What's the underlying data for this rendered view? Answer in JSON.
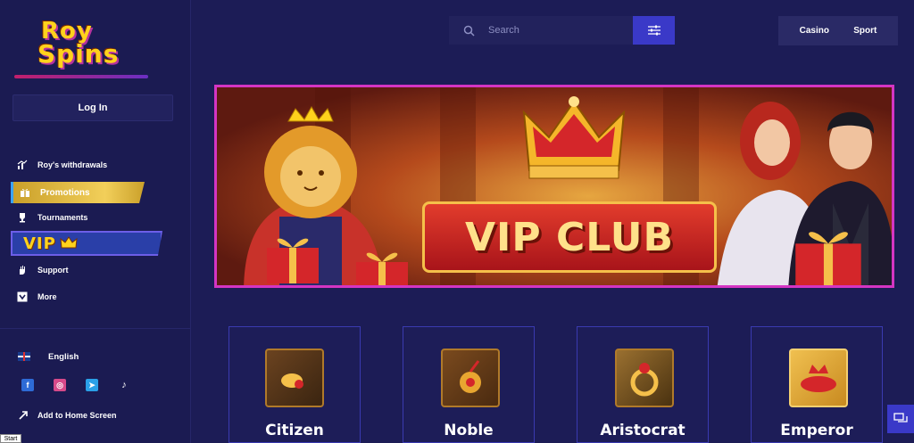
{
  "brand": {
    "logo_line1": "Roy",
    "logo_line2": "Spins",
    "colors": {
      "gold": "#ffd21c",
      "accent": "#3a39c8",
      "bg": "#1c1c56"
    }
  },
  "sidebar": {
    "login_label": "Log In",
    "items": [
      {
        "label": "Roy's withdrawals",
        "icon": "chart-icon"
      },
      {
        "label": "Promotions",
        "icon": "gift-icon"
      },
      {
        "label": "Tournaments",
        "icon": "trophy-icon"
      },
      {
        "label": "VIP",
        "icon": "crown-icon"
      },
      {
        "label": "Support",
        "icon": "hand-icon"
      },
      {
        "label": "More",
        "icon": "chevron-down-icon"
      }
    ],
    "language": "English",
    "socials": [
      "facebook-icon",
      "instagram-icon",
      "telegram-icon",
      "tiktok-icon"
    ],
    "add_home_label": "Add to Home Screen"
  },
  "header": {
    "search_placeholder": "Search",
    "tabs": [
      "Casino",
      "Sport"
    ]
  },
  "banner": {
    "title": "VIP CLUB"
  },
  "tiers": [
    {
      "name": "Citizen"
    },
    {
      "name": "Noble"
    },
    {
      "name": "Aristocrat"
    },
    {
      "name": "Emperor"
    }
  ],
  "taskbar": {
    "start_label": "Start"
  }
}
